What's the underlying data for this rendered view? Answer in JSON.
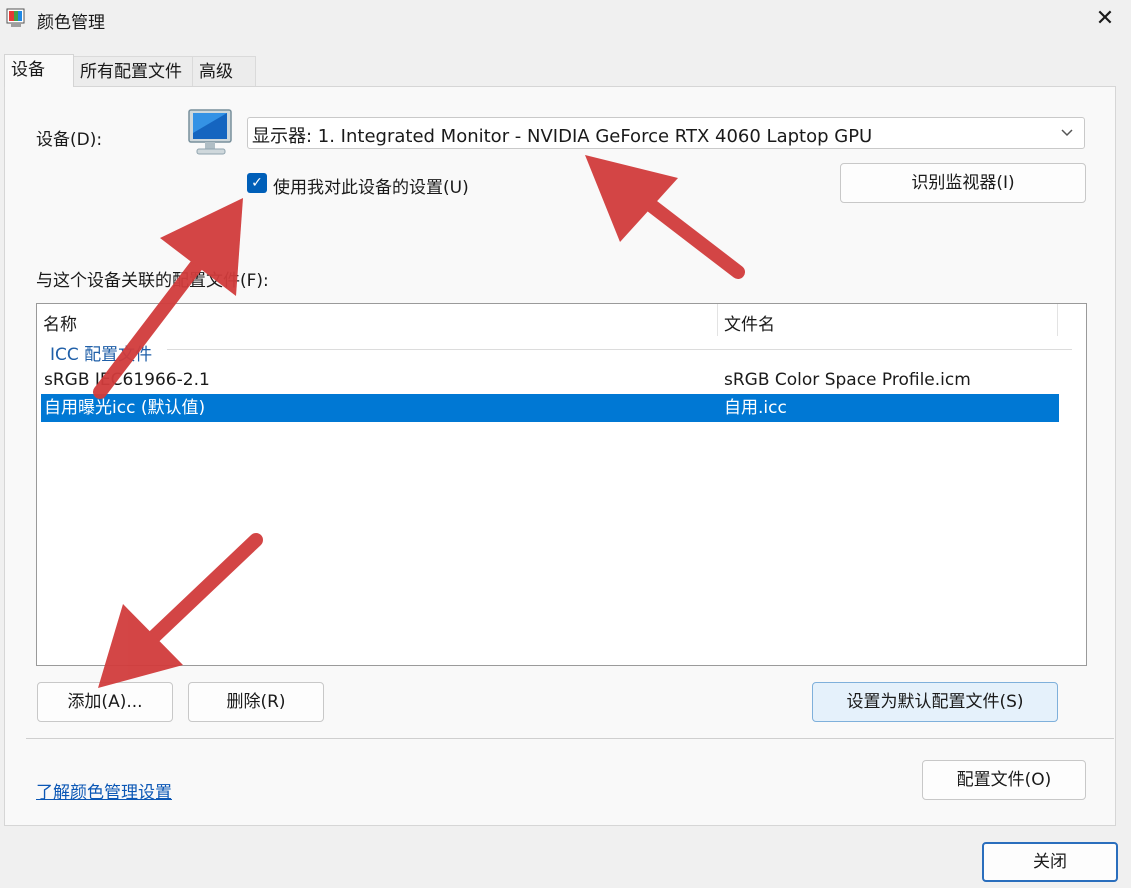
{
  "window": {
    "title": "颜色管理",
    "close_symbol": "✕"
  },
  "tabs": [
    {
      "label": "设备",
      "active": true
    },
    {
      "label": "所有配置文件",
      "active": false
    },
    {
      "label": "高级",
      "active": false
    }
  ],
  "device": {
    "label": "设备(D):",
    "selected": "显示器: 1. Integrated Monitor - NVIDIA GeForce RTX 4060 Laptop GPU",
    "use_settings_label": "使用我对此设备的设置(U)",
    "use_settings_checked": true,
    "identify_button": "识别监视器(I)"
  },
  "profiles": {
    "label": "与这个设备关联的配置文件(F):",
    "columns": [
      "名称",
      "文件名"
    ],
    "group": "ICC 配置文件",
    "rows": [
      {
        "name": "sRGB IEC61966-2.1",
        "file": "sRGB Color Space Profile.icm",
        "selected": false
      },
      {
        "name": "自用曝光icc (默认值)",
        "file": "自用.icc",
        "selected": true
      }
    ]
  },
  "buttons": {
    "add": "添加(A)...",
    "remove": "删除(R)",
    "set_default": "设置为默认配置文件(S)",
    "profiles": "配置文件(O)",
    "close": "关闭"
  },
  "link": "了解颜色管理设置",
  "colors": {
    "accent": "#0078d4",
    "annotation_arrow": "#d13c3c",
    "checkbox": "#005fb8"
  }
}
